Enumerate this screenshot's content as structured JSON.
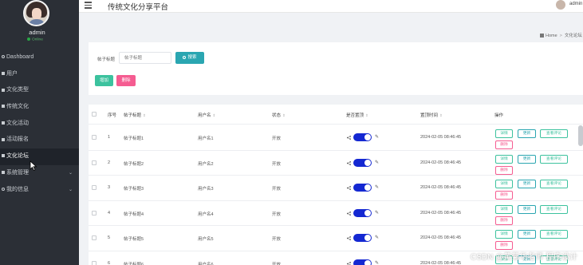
{
  "header": {
    "title": "传统文化分享平台",
    "user": "admin"
  },
  "profile": {
    "name": "admin",
    "status": "Online"
  },
  "sidebar": {
    "items": [
      {
        "label": "Dashboard",
        "expandable": false
      },
      {
        "label": "用户",
        "expandable": false
      },
      {
        "label": "文化类型",
        "expandable": false
      },
      {
        "label": "传统文化",
        "expandable": false
      },
      {
        "label": "文化活动",
        "expandable": false
      },
      {
        "label": "活动报名",
        "expandable": false
      },
      {
        "label": "文化论坛",
        "expandable": false,
        "active": true
      },
      {
        "label": "系统管理",
        "expandable": true
      },
      {
        "label": "我的信息",
        "expandable": true
      }
    ]
  },
  "breadcrumb": {
    "home": "Home",
    "current": "文化论坛"
  },
  "search": {
    "label": "帖子标题",
    "placeholder": "帖子标题",
    "button": "搜索",
    "add": "增加",
    "delete": "删除"
  },
  "table": {
    "columns": [
      "序号",
      "帖子标题",
      "用户名",
      "状态",
      "是否置顶",
      "置顶时间",
      "操作"
    ],
    "rows": [
      {
        "index": "1",
        "title": "帖子标题1",
        "user": "用户名1",
        "status": "开放",
        "time": "2024-02-05 08:46:45"
      },
      {
        "index": "2",
        "title": "帖子标题2",
        "user": "用户名2",
        "status": "开放",
        "time": "2024-02-05 08:46:45"
      },
      {
        "index": "3",
        "title": "帖子标题3",
        "user": "用户名3",
        "status": "开放",
        "time": "2024-02-05 08:46:45"
      },
      {
        "index": "4",
        "title": "帖子标题4",
        "user": "用户名4",
        "status": "开放",
        "time": "2024-02-05 08:46:45"
      },
      {
        "index": "5",
        "title": "帖子标题5",
        "user": "用户名5",
        "status": "开放",
        "time": "2024-02-05 08:46:45"
      },
      {
        "index": "6",
        "title": "帖子标题6",
        "user": "用户名6",
        "status": "开放",
        "time": "2024-02-05 08:46:45"
      }
    ],
    "actions": {
      "detail": "详情",
      "update": "更新",
      "review": "查看评论",
      "delete": "删除"
    }
  },
  "colors": {
    "sidebar": "#2b2f36",
    "primary": "#2aa6b1",
    "success": "#3cc29e",
    "danger": "#f55c91",
    "toggle": "#1428d2"
  },
  "watermark": "CSDN @黄菊华老师 程序设计"
}
